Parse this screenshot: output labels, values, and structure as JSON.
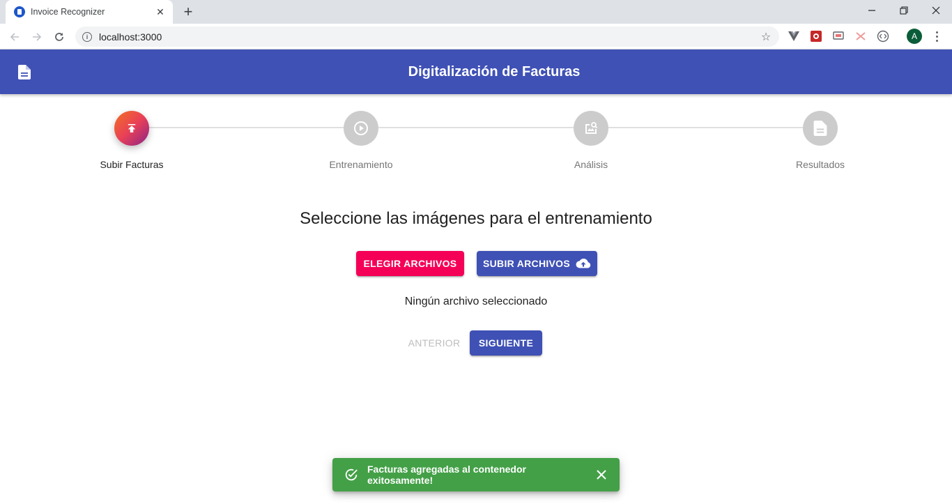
{
  "browser": {
    "tab_title": "Invoice Recognizer",
    "url": "localhost:3000",
    "profile_initial": "A"
  },
  "app": {
    "title": "Digitalización de Facturas",
    "primary_color": "#3f51b5",
    "secondary_color": "#f50057"
  },
  "stepper": {
    "active_index": 0,
    "steps": [
      {
        "label": "Subir Facturas",
        "icon": "upload-icon"
      },
      {
        "label": "Entrenamiento",
        "icon": "play-circle-icon"
      },
      {
        "label": "Análisis",
        "icon": "image-search-icon"
      },
      {
        "label": "Resultados",
        "icon": "document-icon"
      }
    ]
  },
  "main": {
    "heading": "Seleccione las imágenes para el entrenamiento",
    "choose_files_label": "ELEGIR ARCHIVOS",
    "upload_files_label": "SUBIR ARCHIVOS",
    "file_status": "Ningún archivo seleccionado",
    "back_label": "ANTERIOR",
    "next_label": "SIGUIENTE"
  },
  "snackbar": {
    "message": "Facturas agregadas al contenedor exitosamente!",
    "color": "#43a047"
  }
}
